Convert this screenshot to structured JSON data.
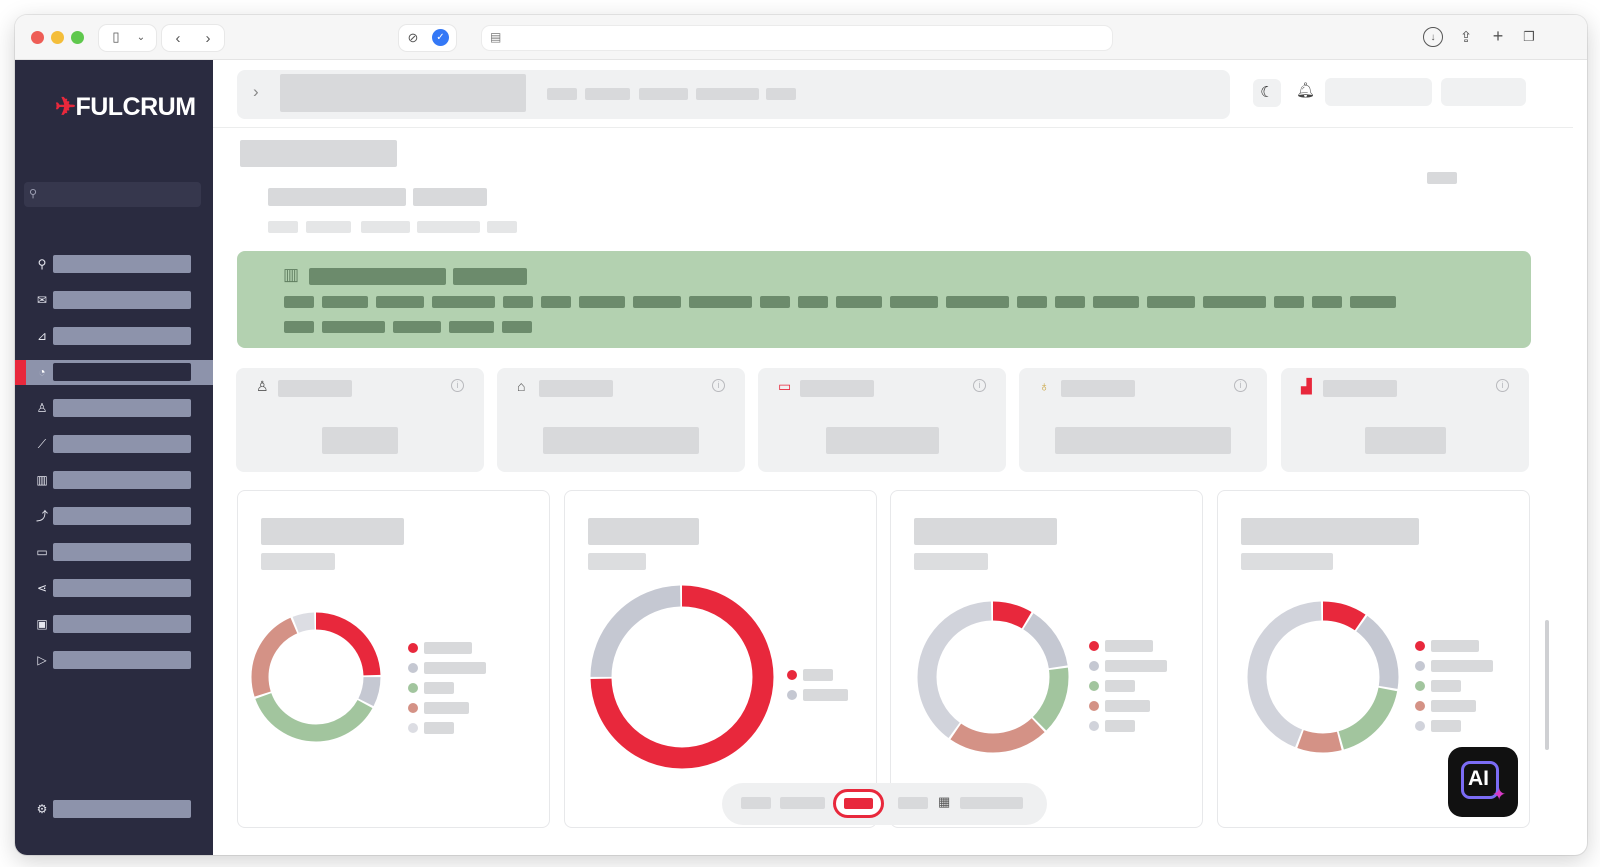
{
  "brand": {
    "name": "FULCRUM",
    "accent": "#e8283c",
    "sidebar_bg": "#2a2b40",
    "banner_bg": "#b3d1b0"
  },
  "chrome": {
    "icons": [
      "sidebar-toggle-icon",
      "chevron-down-icon",
      "back-icon",
      "forward-icon",
      "privacy-icon",
      "verified-icon",
      "reader-icon",
      "download-icon",
      "share-icon",
      "new-tab-icon",
      "tabs-icon"
    ]
  },
  "sidebar": {
    "items": [
      {
        "icon": "pin-icon",
        "glyph": "⚲"
      },
      {
        "icon": "mail-icon",
        "glyph": "✉"
      },
      {
        "icon": "chart-area-icon",
        "glyph": "⊿"
      },
      {
        "icon": "pie-clock-icon",
        "glyph": "◔",
        "active": true
      },
      {
        "icon": "user-icon",
        "glyph": "♙"
      },
      {
        "icon": "line-chart-icon",
        "glyph": "⟋"
      },
      {
        "icon": "bar-chart-icon",
        "glyph": "▥"
      },
      {
        "icon": "trend-icon",
        "glyph": "⤴"
      },
      {
        "icon": "chat-icon",
        "glyph": "▭"
      },
      {
        "icon": "share-nodes-icon",
        "glyph": "⋖"
      },
      {
        "icon": "image-icon",
        "glyph": "▣"
      },
      {
        "icon": "play-icon",
        "glyph": "▷"
      }
    ],
    "settings_icon": "gear-icon"
  },
  "stats": [
    {
      "icon": "user-icon",
      "glyph": "♙",
      "color": "#555"
    },
    {
      "icon": "briefcase-icon",
      "glyph": "⌂",
      "color": "#555"
    },
    {
      "icon": "wallet-icon",
      "glyph": "▭",
      "color": "#e8283c"
    },
    {
      "icon": "award-icon",
      "glyph": "♁",
      "color": "#c9a23a"
    },
    {
      "icon": "signal-icon",
      "glyph": "▟",
      "color": "#e8283c"
    }
  ],
  "donuts": [
    {
      "segments": [
        [
          "#e8283c",
          0.25
        ],
        [
          "#c5c8d2",
          0.08
        ],
        [
          "#a2c59e",
          0.37
        ],
        [
          "#d49286",
          0.24
        ],
        [
          "#dcdde3",
          0.06
        ]
      ],
      "legend": [
        "#e8283c",
        "#c5c8d2",
        "#a2c59e",
        "#d49286",
        "#dcdde3"
      ]
    },
    {
      "segments": [
        [
          "#e8283c",
          0.75
        ],
        [
          "#c5c8d2",
          0.25
        ]
      ],
      "legend": [
        "#e8283c",
        "#c5c8d2"
      ]
    },
    {
      "segments": [
        [
          "#e8283c",
          0.09
        ],
        [
          "#c5c8d2",
          0.14
        ],
        [
          "#a2c59e",
          0.15
        ],
        [
          "#d49286",
          0.22
        ],
        [
          "#d1d3db",
          0.4
        ]
      ],
      "legend": [
        "#e8283c",
        "#c5c8d2",
        "#a2c59e",
        "#d49286",
        "#d1d3db"
      ]
    },
    {
      "segments": [
        [
          "#e8283c",
          0.1
        ],
        [
          "#c5c8d2",
          0.18
        ],
        [
          "#a2c59e",
          0.18
        ],
        [
          "#d49286",
          0.1
        ],
        [
          "#d1d3db",
          0.44
        ]
      ],
      "legend": [
        "#e8283c",
        "#c5c8d2",
        "#a2c59e",
        "#d49286",
        "#d1d3db"
      ]
    }
  ],
  "ai_button": {
    "label": "AI"
  }
}
